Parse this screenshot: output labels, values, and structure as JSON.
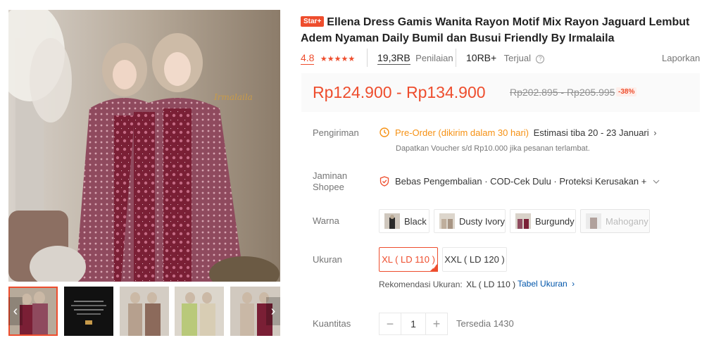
{
  "gallery": {
    "thumbnail_count": 5,
    "main_image_caption": "Irmalaila"
  },
  "product": {
    "badge": "Star+",
    "title": "Ellena Dress Gamis Wanita Rayon Motif Mix Rayon Jaguard Lembut Adem Nyaman Daily Bumil dan Busui Friendly By Irmalaila"
  },
  "stats": {
    "rating": "4.8",
    "stars": 5,
    "reviews_count": "19,3RB",
    "reviews_label": "Penilaian",
    "sold_count": "10RB+",
    "sold_label": "Terjual",
    "report_label": "Laporkan"
  },
  "price": {
    "current": "Rp124.900 - Rp134.900",
    "original": "Rp202.895 - Rp205.995",
    "discount": "-38%"
  },
  "shipping": {
    "label": "Pengiriman",
    "preorder": "Pre-Order (dikirim dalam 30 hari)",
    "estimate": "Estimasi tiba 20 - 23 Januari",
    "voucher_note": "Dapatkan Voucher s/d Rp10.000 jika pesanan terlambat."
  },
  "guarantee": {
    "label_line1": "Jaminan",
    "label_line2": "Shopee",
    "text": "Bebas Pengembalian · COD-Cek Dulu · Proteksi Kerusakan +"
  },
  "color": {
    "label": "Warna",
    "options": [
      {
        "label": "Black",
        "disabled": false
      },
      {
        "label": "Dusty Ivory",
        "disabled": false
      },
      {
        "label": "Burgundy",
        "disabled": false
      },
      {
        "label": "Mahogany",
        "disabled": true
      }
    ]
  },
  "size": {
    "label": "Ukuran",
    "options": [
      {
        "label": "XL ( LD 110 )",
        "selected": true
      },
      {
        "label": "XXL ( LD 120 )",
        "selected": false
      }
    ],
    "recommend_label": "Rekomendasi Ukuran:",
    "recommend_value": "XL ( LD 110 )",
    "size_chart_link": "Tabel Ukuran"
  },
  "quantity": {
    "label": "Kuantitas",
    "value": "1",
    "minus": "−",
    "plus": "+",
    "stock": "Tersedia 1430"
  },
  "colors": {
    "accent": "#ee4d2d",
    "preorder": "#f69113",
    "link": "#05a"
  },
  "icons": [
    "chevron-left-icon",
    "chevron-right-icon",
    "star-icon",
    "help-icon",
    "clock-icon",
    "shield-icon",
    "chevron-down-icon"
  ]
}
